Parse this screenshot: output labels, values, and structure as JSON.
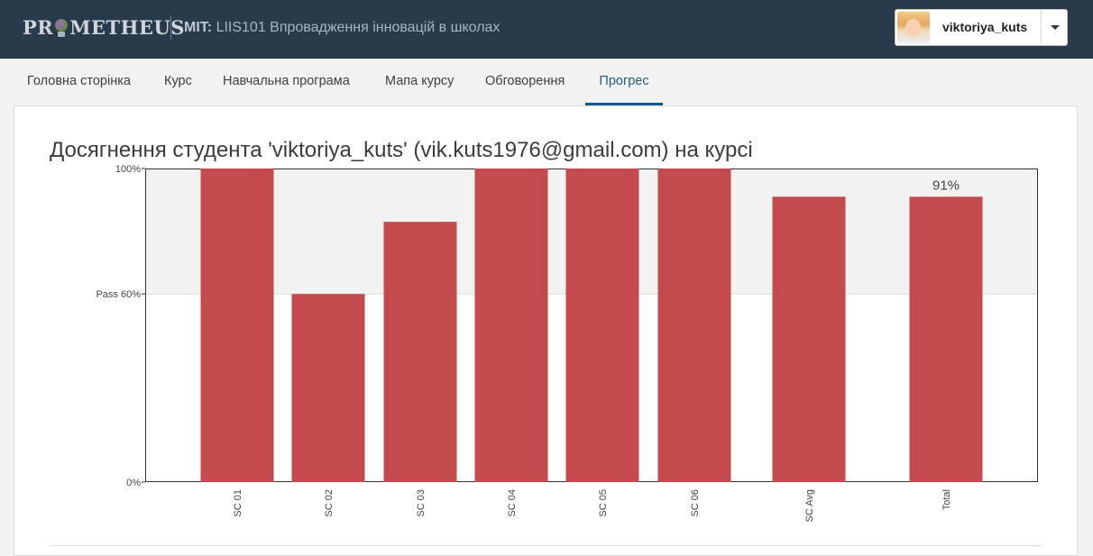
{
  "header": {
    "logo_text": "PROMETHEUS",
    "course_org": "MIT:",
    "course_name": "LIIS101 Впровадження інновацій в школах",
    "username": "viktoriya_kuts"
  },
  "tabs": [
    {
      "label": "Головна сторінка"
    },
    {
      "label": "Курс"
    },
    {
      "label": "Навчальна програма"
    },
    {
      "label": "Мапа курсу"
    },
    {
      "label": "Обговорення"
    },
    {
      "label": "Прогрес",
      "active": true
    }
  ],
  "page": {
    "title": "Досягнення студента 'viktoriya_kuts' (vik.kuts1976@gmail.com) на курсі"
  },
  "colors": {
    "bar": "#c54a4d",
    "pass_band": "#f2f2f2",
    "header_bg": "#293a4b",
    "active_tab": "#0e5a8a"
  },
  "chart_data": {
    "type": "bar",
    "categories": [
      "SC 01",
      "SC 02",
      "SC 03",
      "SC 04",
      "SC 05",
      "SC 06",
      "SC Avg",
      "Total"
    ],
    "values": [
      100,
      60,
      83,
      100,
      100,
      100,
      91,
      91
    ],
    "data_labels": {
      "7": "91%"
    },
    "ylim": [
      0,
      100
    ],
    "y_ticks": [
      {
        "value": 0,
        "label": "0%"
      },
      {
        "value": 60,
        "label": "Pass 60%"
      },
      {
        "value": 100,
        "label": "100%"
      }
    ],
    "pass_threshold": 60,
    "grid": false,
    "title": "",
    "xlabel": "",
    "ylabel": ""
  }
}
